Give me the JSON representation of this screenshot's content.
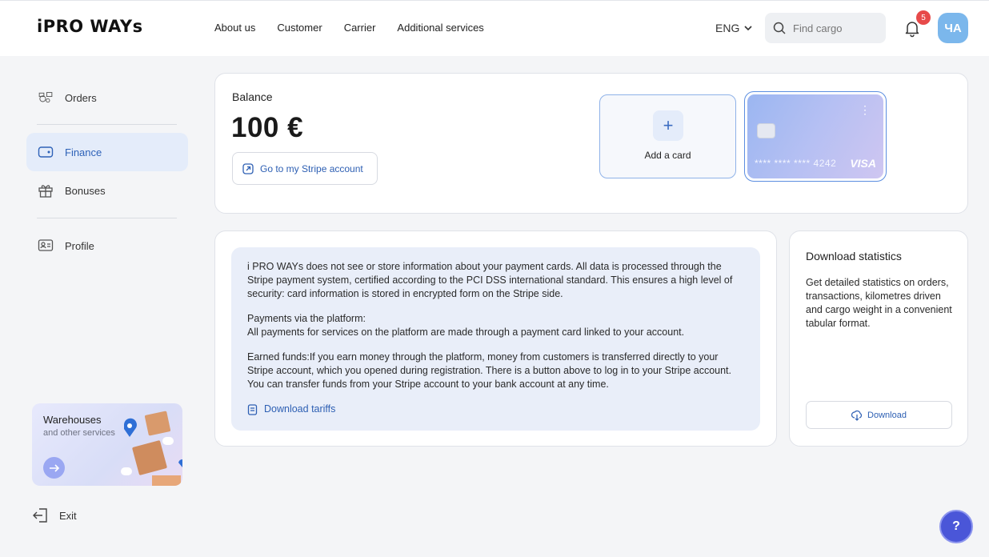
{
  "header": {
    "logo": "iPRO WAYs",
    "nav": [
      "About us",
      "Customer",
      "Carrier",
      "Additional services"
    ],
    "language": "ENG",
    "search_placeholder": "Find cargo",
    "notifications_count": "5",
    "avatar_initials": "ЧА"
  },
  "sidebar": {
    "items": [
      {
        "label": "Orders",
        "icon": "orders-icon"
      },
      {
        "label": "Finance",
        "icon": "wallet-icon",
        "active": true
      },
      {
        "label": "Bonuses",
        "icon": "gift-icon"
      },
      {
        "label": "Profile",
        "icon": "id-card-icon"
      }
    ],
    "promo": {
      "title": "Warehouses",
      "subtitle": "and other services"
    },
    "exit_label": "Exit"
  },
  "balance": {
    "label": "Balance",
    "value": "100 €",
    "stripe_button": "Go to my Stripe account",
    "add_card_label": "Add a card",
    "card_number": "**** **** **** 4242",
    "card_brand": "VISA"
  },
  "info": {
    "paragraphs": [
      "i PRO WAYs does not see or store information about your payment cards. All data is processed through the Stripe payment system, certified according to the PCI DSS international standard. This ensures a high level of security: card information is stored in encrypted form on the Stripe side.",
      "Payments via the platform:",
      "All payments for services on the platform are made through a payment card linked to your account.",
      "Earned funds:If you earn money through the platform, money from customers is transferred directly to your Stripe account, which you opened during registration. There is a button above to log in to your Stripe account. You can transfer funds from your Stripe account to your bank account at any time."
    ],
    "tariffs_link": "Download tariffs"
  },
  "stats": {
    "title": "Download statistics",
    "text": "Get detailed statistics on orders, transactions, kilometres driven and cargo weight in a convenient tabular format.",
    "button": "Download"
  },
  "help_label": "?",
  "colors": {
    "accent": "#2d5fb3",
    "active_bg": "#e4ecfa",
    "badge": "#e74a4a",
    "help": "#4a56d8"
  }
}
